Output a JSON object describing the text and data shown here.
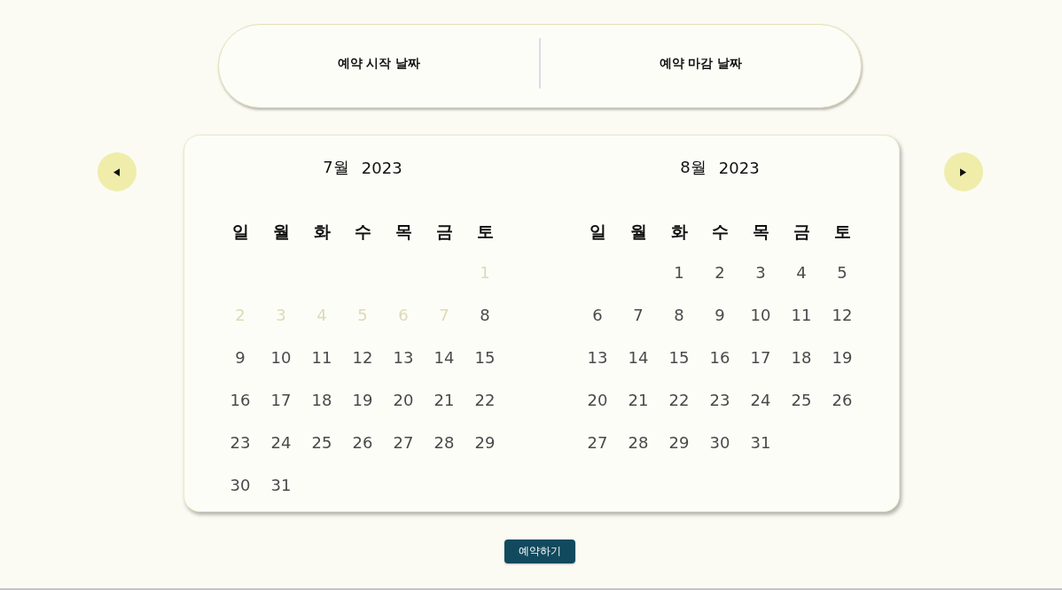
{
  "date_range": {
    "start_label": "예약 시작 날짜",
    "end_label": "예약 마감 날짜"
  },
  "calendar": {
    "months": [
      {
        "month": "7월",
        "year": "2023",
        "weekdays": [
          "일",
          "월",
          "화",
          "수",
          "목",
          "금",
          "토"
        ],
        "weeks": [
          {
            "kind": "first",
            "days": [
              {
                "day": "1",
                "disabled": true
              }
            ]
          },
          {
            "kind": "week",
            "days": [
              {
                "day": "2",
                "disabled": true
              },
              {
                "day": "3",
                "disabled": true
              },
              {
                "day": "4",
                "disabled": true
              },
              {
                "day": "5",
                "disabled": true
              },
              {
                "day": "6",
                "disabled": true
              },
              {
                "day": "7",
                "disabled": true
              },
              {
                "day": "8",
                "disabled": false
              }
            ]
          },
          {
            "kind": "week",
            "days": [
              {
                "day": "9",
                "disabled": false
              },
              {
                "day": "10",
                "disabled": false
              },
              {
                "day": "11",
                "disabled": false
              },
              {
                "day": "12",
                "disabled": false
              },
              {
                "day": "13",
                "disabled": false
              },
              {
                "day": "14",
                "disabled": false
              },
              {
                "day": "15",
                "disabled": false
              }
            ]
          },
          {
            "kind": "week",
            "days": [
              {
                "day": "16",
                "disabled": false
              },
              {
                "day": "17",
                "disabled": false
              },
              {
                "day": "18",
                "disabled": false
              },
              {
                "day": "19",
                "disabled": false
              },
              {
                "day": "20",
                "disabled": false
              },
              {
                "day": "21",
                "disabled": false
              },
              {
                "day": "22",
                "disabled": false
              }
            ]
          },
          {
            "kind": "week",
            "days": [
              {
                "day": "23",
                "disabled": false
              },
              {
                "day": "24",
                "disabled": false
              },
              {
                "day": "25",
                "disabled": false
              },
              {
                "day": "26",
                "disabled": false
              },
              {
                "day": "27",
                "disabled": false
              },
              {
                "day": "28",
                "disabled": false
              },
              {
                "day": "29",
                "disabled": false
              }
            ]
          },
          {
            "kind": "week",
            "days": [
              {
                "day": "30",
                "disabled": false
              },
              {
                "day": "31",
                "disabled": false
              }
            ]
          }
        ]
      },
      {
        "month": "8월",
        "year": "2023",
        "weekdays": [
          "일",
          "월",
          "화",
          "수",
          "목",
          "금",
          "토"
        ],
        "weeks": [
          {
            "kind": "first",
            "days": [
              {
                "day": "1",
                "disabled": false
              },
              {
                "day": "2",
                "disabled": false
              },
              {
                "day": "3",
                "disabled": false
              },
              {
                "day": "4",
                "disabled": false
              },
              {
                "day": "5",
                "disabled": false
              }
            ]
          },
          {
            "kind": "week",
            "days": [
              {
                "day": "6",
                "disabled": false
              },
              {
                "day": "7",
                "disabled": false
              },
              {
                "day": "8",
                "disabled": false
              },
              {
                "day": "9",
                "disabled": false
              },
              {
                "day": "10",
                "disabled": false
              },
              {
                "day": "11",
                "disabled": false
              },
              {
                "day": "12",
                "disabled": false
              }
            ]
          },
          {
            "kind": "week",
            "days": [
              {
                "day": "13",
                "disabled": false
              },
              {
                "day": "14",
                "disabled": false
              },
              {
                "day": "15",
                "disabled": false
              },
              {
                "day": "16",
                "disabled": false
              },
              {
                "day": "17",
                "disabled": false
              },
              {
                "day": "18",
                "disabled": false
              },
              {
                "day": "19",
                "disabled": false
              }
            ]
          },
          {
            "kind": "week",
            "days": [
              {
                "day": "20",
                "disabled": false
              },
              {
                "day": "21",
                "disabled": false
              },
              {
                "day": "22",
                "disabled": false
              },
              {
                "day": "23",
                "disabled": false
              },
              {
                "day": "24",
                "disabled": false
              },
              {
                "day": "25",
                "disabled": false
              },
              {
                "day": "26",
                "disabled": false
              }
            ]
          },
          {
            "kind": "week",
            "days": [
              {
                "day": "27",
                "disabled": false
              },
              {
                "day": "28",
                "disabled": false
              },
              {
                "day": "29",
                "disabled": false
              },
              {
                "day": "30",
                "disabled": false
              },
              {
                "day": "31",
                "disabled": false
              }
            ]
          }
        ]
      }
    ]
  },
  "submit_button": "예약하기"
}
